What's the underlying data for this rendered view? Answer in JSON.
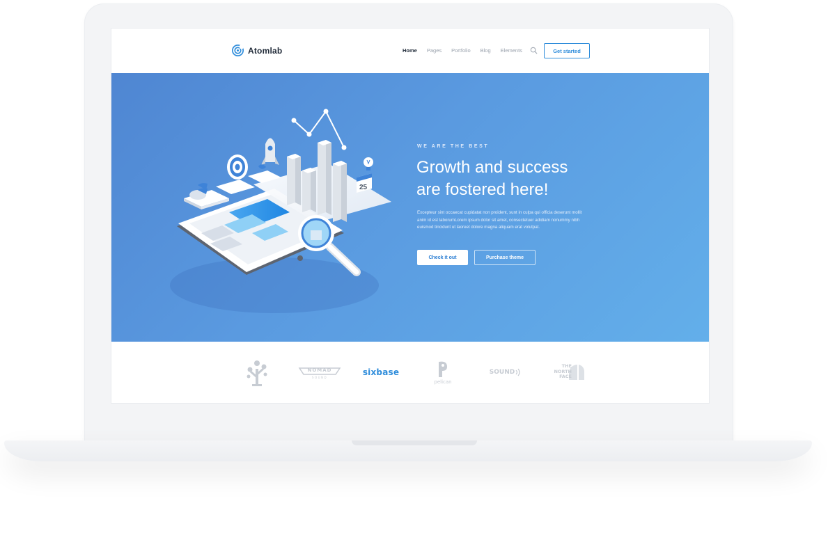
{
  "brand": {
    "name": "Atomlab",
    "accent_color": "#2f8ddb",
    "logo_icon": "target-circle-icon"
  },
  "nav": {
    "items": [
      {
        "label": "Home",
        "active": true
      },
      {
        "label": "Pages",
        "active": false
      },
      {
        "label": "Portfolio",
        "active": false
      },
      {
        "label": "Blog",
        "active": false
      },
      {
        "label": "Elements",
        "active": false
      }
    ],
    "search_icon": "search-icon",
    "cta_label": "Get started"
  },
  "hero": {
    "eyebrow": "WE ARE THE BEST",
    "headline_line1": "Growth and success",
    "headline_line2": "are fostered here!",
    "body": "Excepteur sint occaecat cupidatat non proident, sunt in culpa qui officia deserunt mollit anim id est laborumLorem ipsum dolor sit amet, consectetuer adidiam nonummy nibh euismod tincidunt ut laoreet dolore magna aliquam erat volutpat.",
    "primary_button": "Check it out",
    "secondary_button": "Purchase theme",
    "calendar_day": "25",
    "gradient_start": "#4f86d2",
    "gradient_end": "#63afea"
  },
  "partners": {
    "nomad_top": "NOMAD",
    "nomad_bottom": "SOUND",
    "sixbase": "sixbase",
    "pelican": "pelican",
    "sound": "SOUND",
    "northface_line1": "THE",
    "northface_line2": "NORTH",
    "northface_line3": "FACE",
    "logo_color": "#c7ccd3",
    "highlight_color": "#2f8ddb"
  }
}
